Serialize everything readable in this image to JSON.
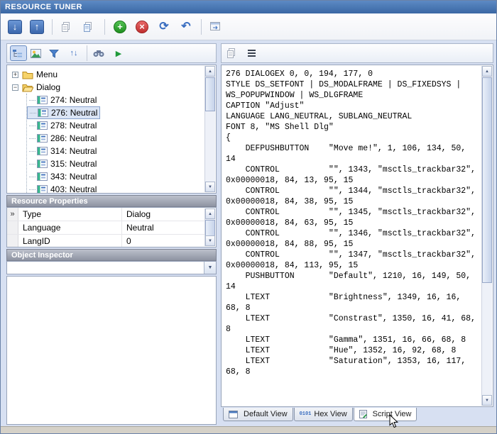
{
  "window": {
    "title": "RESOURCE TUNER"
  },
  "colors": {
    "titlebar_blue": "#3a67a4",
    "accent_blue": "#3a6ec0",
    "add_green": "#1f8f1f",
    "delete_red": "#c02f2f",
    "selection_border": "#88a2cc",
    "header_gray": "#8e93a2"
  },
  "icons": {
    "down_arrow": "↓",
    "up_arrow": "↑",
    "add": "+",
    "delete": "×",
    "refresh": "⟳",
    "undo": "↶",
    "sort": "↑↓",
    "run": "▶",
    "row_marker": "»",
    "scroll_up": "▲",
    "scroll_down": "▼",
    "dropdown": "▼",
    "hex": "0101",
    "expand": "+",
    "collapse": "−"
  },
  "tree": {
    "roots": [
      {
        "label": "Menu",
        "expanded": false
      },
      {
        "label": "Dialog",
        "expanded": true
      }
    ],
    "dialog_children": [
      {
        "label": "274: Neutral",
        "selected": false
      },
      {
        "label": "276: Neutral",
        "selected": true
      },
      {
        "label": "278: Neutral",
        "selected": false
      },
      {
        "label": "286: Neutral",
        "selected": false
      },
      {
        "label": "314: Neutral",
        "selected": false
      },
      {
        "label": "315: Neutral",
        "selected": false
      },
      {
        "label": "343: Neutral",
        "selected": false
      },
      {
        "label": "403: Neutral",
        "selected": false
      }
    ]
  },
  "resource_properties": {
    "title": "Resource Properties",
    "rows": [
      {
        "name": "Type",
        "value": "Dialog"
      },
      {
        "name": "Language",
        "value": "Neutral"
      },
      {
        "name": "LangID",
        "value": "0"
      }
    ]
  },
  "object_inspector": {
    "title": "Object Inspector"
  },
  "script_view": {
    "text": "276 DIALOGEX 0, 0, 194, 177, 0\nSTYLE DS_SETFONT | DS_MODALFRAME | DS_FIXEDSYS |\nWS_POPUPWINDOW | WS_DLGFRAME\nCAPTION \"Adjust\"\nLANGUAGE LANG_NEUTRAL, SUBLANG_NEUTRAL\nFONT 8, \"MS Shell Dlg\"\n{\n    DEFPUSHBUTTON    \"Move me!\", 1, 106, 134, 50,\n14\n    CONTROL          \"\", 1343, \"msctls_trackbar32\",\n0x00000018, 84, 13, 95, 15\n    CONTROL          \"\", 1344, \"msctls_trackbar32\",\n0x00000018, 84, 38, 95, 15\n    CONTROL          \"\", 1345, \"msctls_trackbar32\",\n0x00000018, 84, 63, 95, 15\n    CONTROL          \"\", 1346, \"msctls_trackbar32\",\n0x00000018, 84, 88, 95, 15\n    CONTROL          \"\", 1347, \"msctls_trackbar32\",\n0x00000018, 84, 113, 95, 15\n    PUSHBUTTON       \"Default\", 1210, 16, 149, 50,\n14\n    LTEXT            \"Brightness\", 1349, 16, 16,\n68, 8\n    LTEXT            \"Constrast\", 1350, 16, 41, 68,\n8\n    LTEXT            \"Gamma\", 1351, 16, 66, 68, 8\n    LTEXT            \"Hue\", 1352, 16, 92, 68, 8\n    LTEXT            \"Saturation\", 1353, 16, 117,\n68, 8"
  },
  "tabs": [
    {
      "label": "Default View",
      "active": false
    },
    {
      "label": "Hex View",
      "active": false
    },
    {
      "label": "Script View",
      "active": true
    }
  ]
}
